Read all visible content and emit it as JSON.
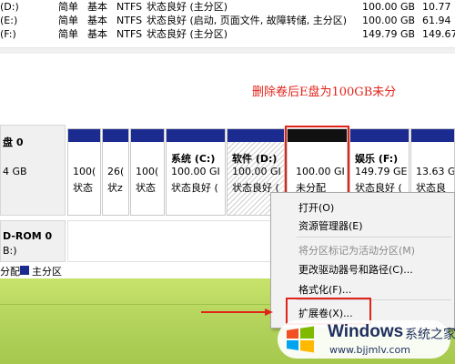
{
  "volume_list": {
    "rows": [
      {
        "name": "(D:)",
        "layout": "简单",
        "type": "基本",
        "fs": "NTFS",
        "status": "状态良好 (主分区)",
        "capacity": "100.00 GB",
        "free": "10.77"
      },
      {
        "name": "(E:)",
        "layout": "简单",
        "type": "基本",
        "fs": "NTFS",
        "status": "状态良好 (启动, 页面文件, 故障转储, 主分区)",
        "capacity": "100.00 GB",
        "free": "61.94"
      },
      {
        "name": "(F:)",
        "layout": "简单",
        "type": "基本",
        "fs": "NTFS",
        "status": "状态良好 (主分区)",
        "capacity": "149.79 GB",
        "free": "149.67"
      }
    ]
  },
  "annotation": "删除卷后E盘为100GB未分",
  "disk0": {
    "title": "盘 0",
    "size": "4 GB"
  },
  "partitions": [
    {
      "l1": "",
      "l2": "100(",
      "l3": "状态"
    },
    {
      "l1": "",
      "l2": "26(",
      "l3": "状z"
    },
    {
      "l1": "",
      "l2": "100(",
      "l3": "状态"
    },
    {
      "l1": "系统  (C:)",
      "l2": "100.00 GI",
      "l3": "状态良好 ("
    },
    {
      "l1": "软件  (D:)",
      "l2": "100.00 GI",
      "l3": "状态良好 ("
    },
    {
      "l1": "",
      "l2": "100.00 GI",
      "l3": "未分配"
    },
    {
      "l1": "娱乐  (F:)",
      "l2": "149.79 GE",
      "l3": "状态良好 ("
    },
    {
      "l1": "",
      "l2": "13.63 G",
      "l3": "状态良"
    }
  ],
  "cdrom": {
    "title": "D-ROM 0",
    "sub": "B:)"
  },
  "legend": {
    "unallocated": "分配",
    "primary": "主分区"
  },
  "context_menu": {
    "items": [
      {
        "label": "打开(O)",
        "disabled": false
      },
      {
        "label": "资源管理器(E)",
        "disabled": false
      },
      {
        "label": "将分区标记为活动分区(M)",
        "disabled": true
      },
      {
        "label": "更改驱动器号和路径(C)...",
        "disabled": false
      },
      {
        "label": "格式化(F)...",
        "disabled": false
      },
      {
        "label": "扩展卷(X)...",
        "disabled": false
      }
    ]
  },
  "watermark": {
    "brand": "Windows",
    "cn": "系统之家",
    "url": "www.bjjmlv.com"
  },
  "colors": {
    "partition_bar": "#1b2b8f",
    "unallocated_bar": "#111111",
    "annotation": "#e2231a"
  }
}
